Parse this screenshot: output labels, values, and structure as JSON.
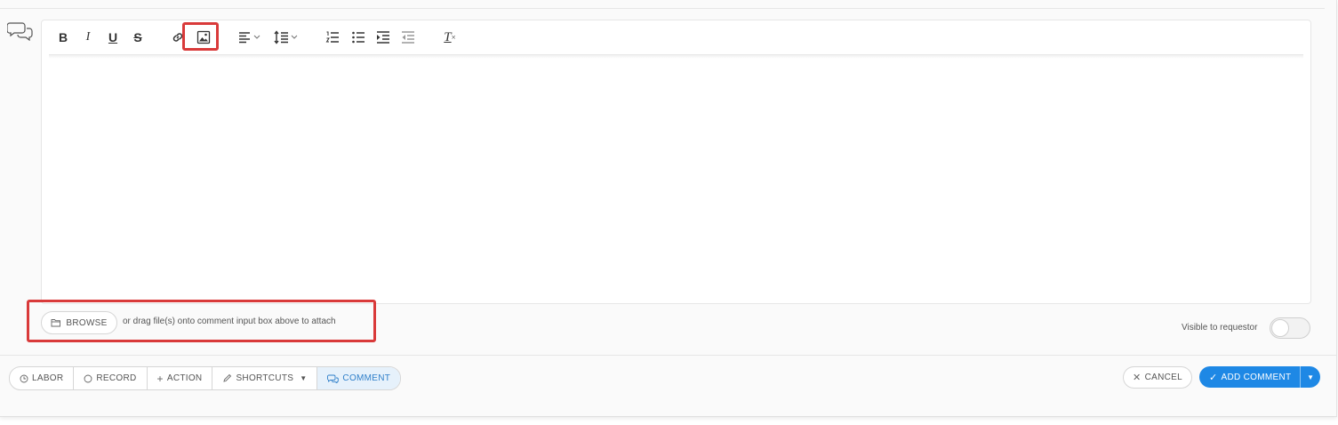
{
  "toolbar": {
    "bold": "B",
    "italic": "I",
    "underline": "U",
    "strike": "S",
    "clear_format": "T"
  },
  "attach": {
    "browse_label": "BROWSE",
    "hint": "or drag file(s) onto comment input box above to attach"
  },
  "visibility": {
    "label": "Visible to requestor",
    "enabled": false
  },
  "actions": {
    "labor": "LABOR",
    "record": "RECORD",
    "action": "ACTION",
    "shortcuts": "SHORTCUTS",
    "comment": "COMMENT"
  },
  "buttons": {
    "cancel": "CANCEL",
    "add_comment": "ADD COMMENT"
  },
  "colors": {
    "primary": "#1e88e5",
    "highlight": "#d93a3a",
    "active_tab_bg": "#e6f1fb"
  }
}
